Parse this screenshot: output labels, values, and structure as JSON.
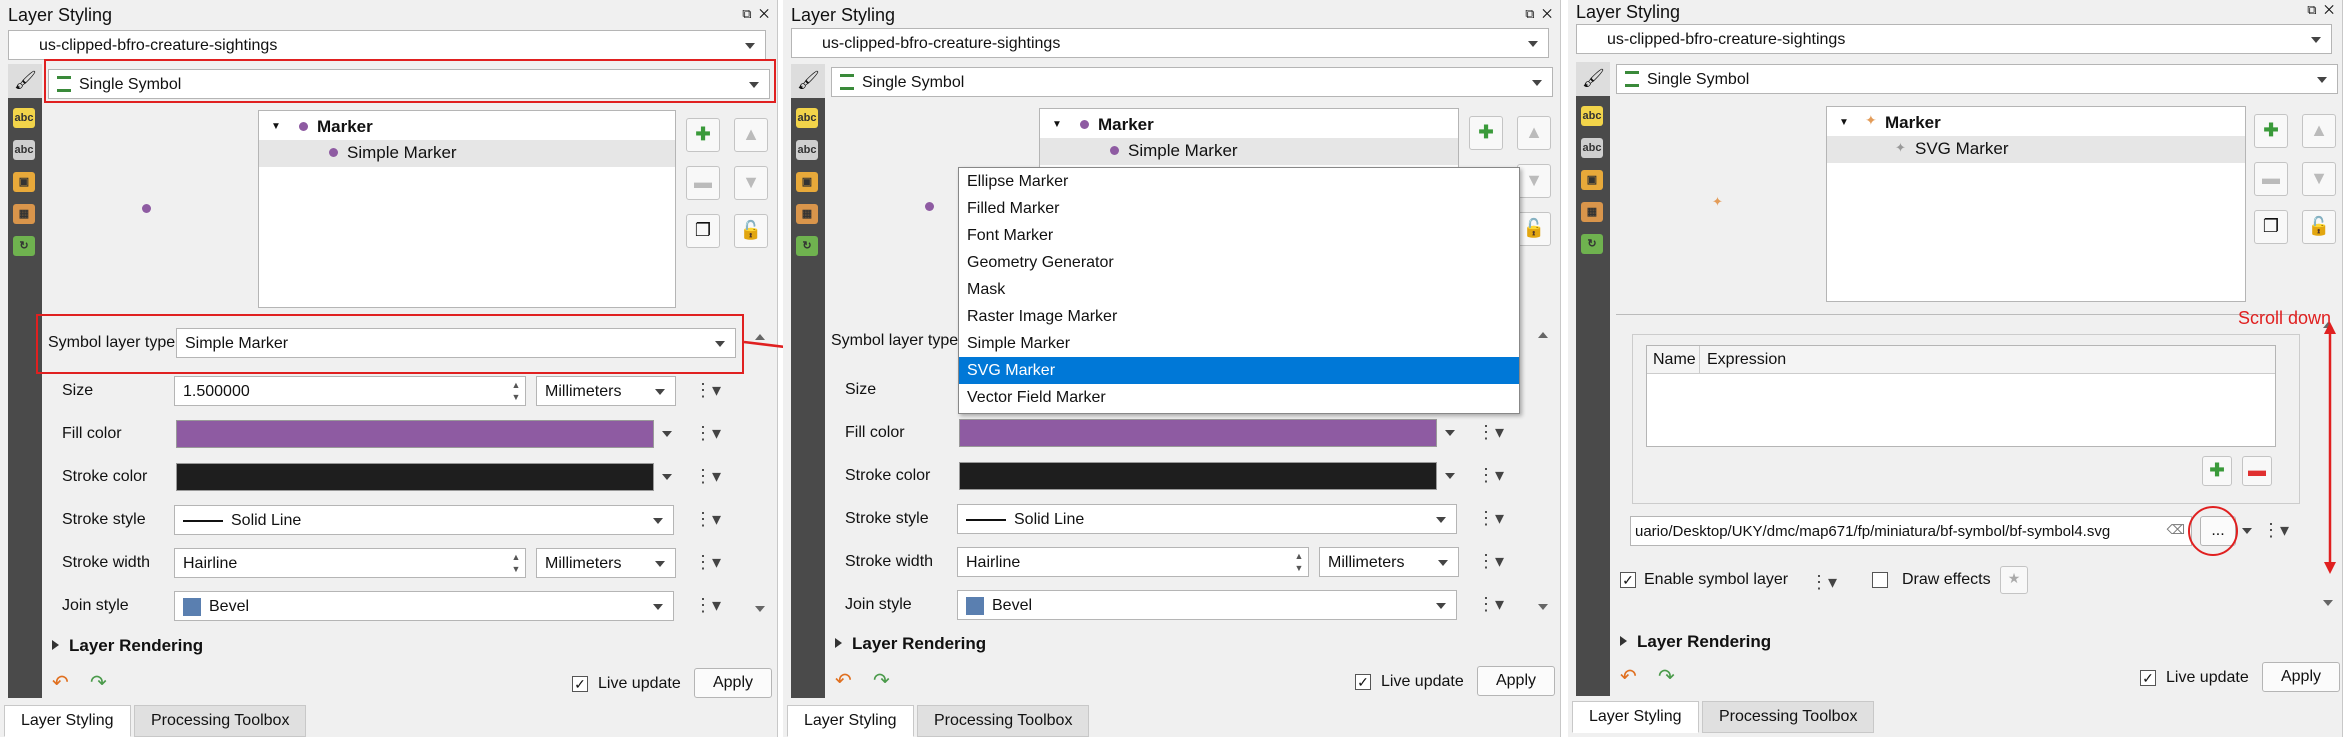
{
  "colors": {
    "accent": "#0078d7",
    "annotation_red": "#e02020",
    "fill": "#8e5ba2",
    "stroke": "#1e1e1e",
    "marker_dot": "#8e5ba2",
    "svg_marker": "#e39c59"
  },
  "panels": [
    {
      "title": "Layer Styling",
      "layer": "us-clipped-bfro-creature-sightings",
      "renderer": "Single Symbol",
      "tree": {
        "root": "Marker",
        "child": "Simple Marker"
      },
      "symbol_layer_type_label": "Symbol layer type",
      "symbol_layer_type_value": "Simple Marker",
      "props": [
        {
          "label": "Size",
          "value": "1.500000",
          "unit": "Millimeters"
        },
        {
          "label": "Fill color"
        },
        {
          "label": "Stroke color"
        },
        {
          "label": "Stroke style",
          "value": "Solid Line"
        },
        {
          "label": "Stroke width",
          "value": "Hairline",
          "unit": "Millimeters"
        },
        {
          "label": "Join style",
          "value": "Bevel"
        }
      ],
      "layer_rendering": "Layer Rendering",
      "live_update": "Live update",
      "apply": "Apply",
      "tabs": [
        "Layer Styling",
        "Processing Toolbox"
      ]
    },
    {
      "title": "Layer Styling",
      "layer": "us-clipped-bfro-creature-sightings",
      "renderer": "Single Symbol",
      "tree": {
        "root": "Marker",
        "child": "Simple Marker"
      },
      "symbol_layer_type_label": "Symbol layer type",
      "props": [
        {
          "label": "Size"
        },
        {
          "label": "Fill color"
        },
        {
          "label": "Stroke color"
        },
        {
          "label": "Stroke style",
          "value": "Solid Line"
        },
        {
          "label": "Stroke width",
          "value": "Hairline",
          "unit": "Millimeters"
        },
        {
          "label": "Join style",
          "value": "Bevel"
        }
      ],
      "layer_rendering": "Layer Rendering",
      "live_update": "Live update",
      "apply": "Apply",
      "tabs": [
        "Layer Styling",
        "Processing Toolbox"
      ]
    },
    {
      "title": "Layer Styling",
      "layer": "us-clipped-bfro-creature-sightings",
      "renderer": "Single Symbol",
      "tree": {
        "root": "Marker",
        "child": "SVG Marker"
      },
      "table_headers": [
        "Name",
        "Expression"
      ],
      "svg_path": "uario/Desktop/UKY/dmc/map671/fp/miniatura/bf-symbol/bf-symbol4.svg",
      "browse_label": "...",
      "enable_symbol_layer": "Enable symbol layer",
      "draw_effects": "Draw effects",
      "layer_rendering": "Layer Rendering",
      "live_update": "Live update",
      "apply": "Apply",
      "tabs": [
        "Layer Styling",
        "Processing Toolbox"
      ],
      "scroll_note": "Scroll down"
    }
  ],
  "dropdown_menu": {
    "items": [
      "Ellipse Marker",
      "Filled Marker",
      "Font Marker",
      "Geometry Generator",
      "Mask",
      "Raster Image Marker",
      "Simple Marker",
      "SVG Marker",
      "Vector Field Marker"
    ],
    "highlighted": "SVG Marker"
  }
}
